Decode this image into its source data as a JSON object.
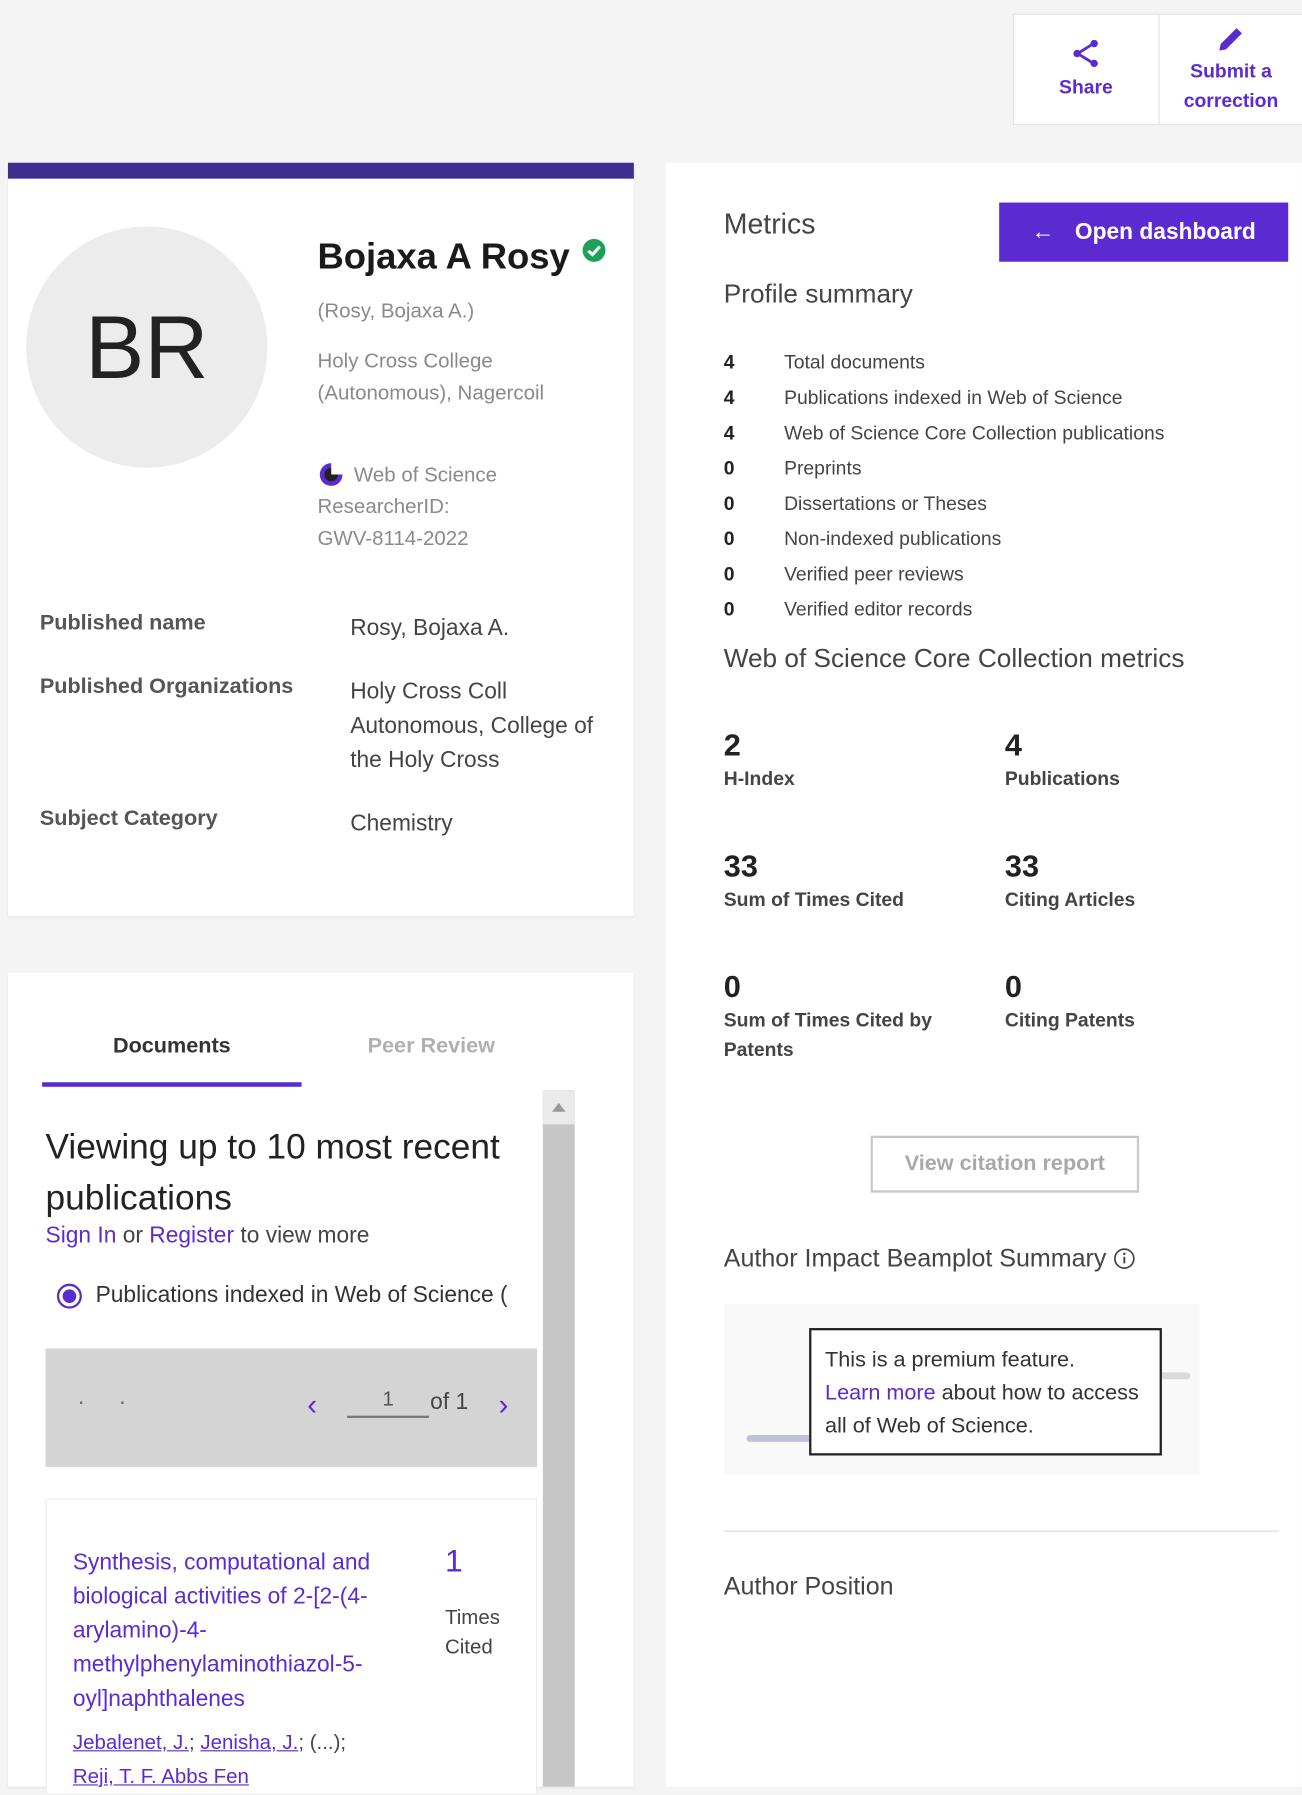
{
  "actions": {
    "share_label": "Share",
    "correction_label_line1": "Submit a",
    "correction_label_line2": "correction"
  },
  "profile": {
    "initials": "BR",
    "name": "Bojaxa A Rosy",
    "alt_name": "(Rosy, Bojaxa A.)",
    "org_line1": "Holy Cross College",
    "org_line2": "(Autonomous), Nagercoil",
    "wos_label": "Web of Science",
    "researcher_id_label": "ResearcherID:",
    "researcher_id": "GWV-8114-2022",
    "details": [
      {
        "label": "Published name",
        "value": "Rosy, Bojaxa A."
      },
      {
        "label": "Published Organizations",
        "value": "Holy Cross Coll Autonomous, College of the Holy Cross"
      },
      {
        "label": "Subject Category",
        "value": "Chemistry"
      }
    ]
  },
  "documents": {
    "tabs": [
      "Documents",
      "Peer Review"
    ],
    "view_title": "Viewing up to 10 most recent publications",
    "sign_in": "Sign In",
    "or_text": "or",
    "register": "Register",
    "view_more": "to view more",
    "filter_option": "Publications indexed in Web of Science (",
    "pager": {
      "dots": "· ·",
      "current": "1",
      "of_text": "of 1"
    },
    "publication": {
      "title": "Synthesis, computational and biological activities of 2-[2-(4-arylamino)-4-methylphenylaminothiazol-5-oyl]naphthalenes",
      "author1": "Jebalenet, J.",
      "author2": "Jenisha, J.",
      "ellipsis": "; (...);",
      "author3": "Reji, T. F. Abbs Fen",
      "times_cited": "1",
      "times_cited_label": "Times Cited"
    }
  },
  "metrics": {
    "title": "Metrics",
    "dashboard_button": "Open dashboard",
    "profile_summary_title": "Profile summary",
    "summary": [
      {
        "count": "4",
        "label": "Total documents"
      },
      {
        "count": "4",
        "label": "Publications indexed in Web of Science"
      },
      {
        "count": "4",
        "label": "Web of Science Core Collection publications"
      },
      {
        "count": "0",
        "label": "Preprints"
      },
      {
        "count": "0",
        "label": "Dissertations or Theses"
      },
      {
        "count": "0",
        "label": "Non-indexed publications"
      },
      {
        "count": "0",
        "label": "Verified peer reviews"
      },
      {
        "count": "0",
        "label": "Verified editor records"
      }
    ],
    "core_title": "Web of Science Core Collection metrics",
    "core": [
      {
        "value": "2",
        "label": "H-Index"
      },
      {
        "value": "4",
        "label": "Publications"
      },
      {
        "value": "33",
        "label": "Sum of Times Cited"
      },
      {
        "value": "33",
        "label": "Citing Articles"
      },
      {
        "value": "0",
        "label": "Sum of Times Cited by Patents"
      },
      {
        "value": "0",
        "label": "Citing Patents"
      }
    ],
    "citation_report_button": "View citation report",
    "beamplot_title": "Author Impact Beamplot Summary",
    "premium_text1": "This is a premium feature.",
    "premium_link": "Learn more",
    "premium_text2": "about how to access all of Web of Science.",
    "author_position_title": "Author Position"
  },
  "colors": {
    "accent": "#5b2bd1",
    "banner": "#3e2e8f",
    "verified": "#1ea05a"
  }
}
